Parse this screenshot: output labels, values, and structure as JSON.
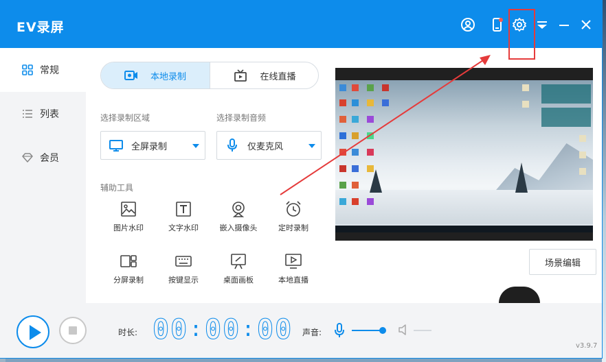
{
  "app": {
    "title": "EV录屏",
    "version": "v3.9.7"
  },
  "sidebar": {
    "items": [
      {
        "label": "常规",
        "icon": "grid-icon",
        "active": true
      },
      {
        "label": "列表",
        "icon": "list-icon",
        "active": false
      },
      {
        "label": "会员",
        "icon": "diamond-icon",
        "active": false
      }
    ]
  },
  "mode": {
    "tabs": [
      {
        "label": "本地录制",
        "icon": "record-icon",
        "active": true
      },
      {
        "label": "在线直播",
        "icon": "tv-icon",
        "active": false
      }
    ]
  },
  "area": {
    "label": "选择录制区域",
    "value": "全屏录制",
    "icon": "monitor-icon"
  },
  "audio": {
    "label": "选择录制音频",
    "value": "仅麦克风",
    "icon": "microphone-icon"
  },
  "tools": {
    "label": "辅助工具",
    "items": [
      {
        "label": "图片水印",
        "icon": "image-icon"
      },
      {
        "label": "文字水印",
        "icon": "text-icon"
      },
      {
        "label": "嵌入摄像头",
        "icon": "webcam-icon"
      },
      {
        "label": "定时录制",
        "icon": "alarm-clock-icon"
      },
      {
        "label": "分屏录制",
        "icon": "split-screen-icon"
      },
      {
        "label": "按键显示",
        "icon": "keyboard-icon"
      },
      {
        "label": "桌面画板",
        "icon": "easel-icon"
      },
      {
        "label": "本地直播",
        "icon": "play-screen-icon"
      }
    ]
  },
  "preview": {
    "scene_button": "场景编辑"
  },
  "bottom": {
    "duration_label": "时长:",
    "timer": {
      "hours": "00",
      "minutes": "00",
      "seconds": "00"
    },
    "volume_label": "声音:",
    "volume": 0.9
  },
  "colors": {
    "accent": "#0d8ceb",
    "annotation": "#e53b3b",
    "sidebar_bg": "#f3f4f6"
  }
}
